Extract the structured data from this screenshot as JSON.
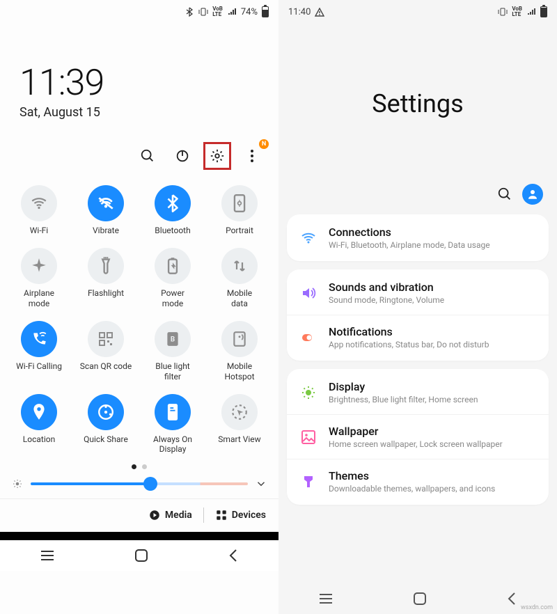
{
  "left": {
    "status": {
      "battery_text": "74%",
      "volte": "VoB LTE"
    },
    "clock": {
      "time": "11:39",
      "date": "Sat, August 15"
    },
    "actions": {
      "more_badge": "N"
    },
    "tiles": [
      {
        "id": "wifi",
        "label": "Wi-Fi",
        "active": false
      },
      {
        "id": "vibrate",
        "label": "Vibrate",
        "active": true
      },
      {
        "id": "bluetooth",
        "label": "Bluetooth",
        "active": true
      },
      {
        "id": "portrait",
        "label": "Portrait",
        "active": false
      },
      {
        "id": "airplane",
        "label": "Airplane\nmode",
        "active": false
      },
      {
        "id": "flashlight",
        "label": "Flashlight",
        "active": false
      },
      {
        "id": "power-mode",
        "label": "Power\nmode",
        "active": false
      },
      {
        "id": "mobile-data",
        "label": "Mobile\ndata",
        "active": false
      },
      {
        "id": "wifi-calling",
        "label": "Wi-Fi Calling",
        "active": true
      },
      {
        "id": "scan-qr",
        "label": "Scan QR code",
        "active": false
      },
      {
        "id": "blue-light",
        "label": "Blue light\nfilter",
        "active": false
      },
      {
        "id": "mobile-hotspot",
        "label": "Mobile\nHotspot",
        "active": false
      },
      {
        "id": "location",
        "label": "Location",
        "active": true
      },
      {
        "id": "quick-share",
        "label": "Quick Share",
        "active": true
      },
      {
        "id": "aod",
        "label": "Always On\nDisplay",
        "active": true
      },
      {
        "id": "smart-view",
        "label": "Smart View",
        "active": false
      }
    ],
    "pager": {
      "pages": 2,
      "current": 0
    },
    "brightness": {
      "percent": 55
    },
    "footer": {
      "media": "Media",
      "devices": "Devices"
    }
  },
  "right": {
    "status": {
      "time": "11:40"
    },
    "title": "Settings",
    "groups": [
      {
        "items": [
          {
            "id": "connections",
            "title": "Connections",
            "sub": "Wi-Fi, Bluetooth, Airplane mode, Data usage",
            "color": "#4aa3ff"
          }
        ]
      },
      {
        "items": [
          {
            "id": "sounds",
            "title": "Sounds and vibration",
            "sub": "Sound mode, Ringtone, Volume",
            "color": "#9a6cff"
          },
          {
            "id": "notifications",
            "title": "Notifications",
            "sub": "App notifications, Status bar, Do not disturb",
            "color": "#ff7a5c"
          }
        ]
      },
      {
        "items": [
          {
            "id": "display",
            "title": "Display",
            "sub": "Brightness, Blue light filter, Home screen",
            "color": "#7ac943"
          },
          {
            "id": "wallpaper",
            "title": "Wallpaper",
            "sub": "Home screen wallpaper, Lock screen wallpaper",
            "color": "#ff5fa2"
          },
          {
            "id": "themes",
            "title": "Themes",
            "sub": "Downloadable themes, wallpapers, and icons",
            "color": "#b262ff"
          }
        ]
      }
    ]
  },
  "watermark": "wsxdn.com"
}
